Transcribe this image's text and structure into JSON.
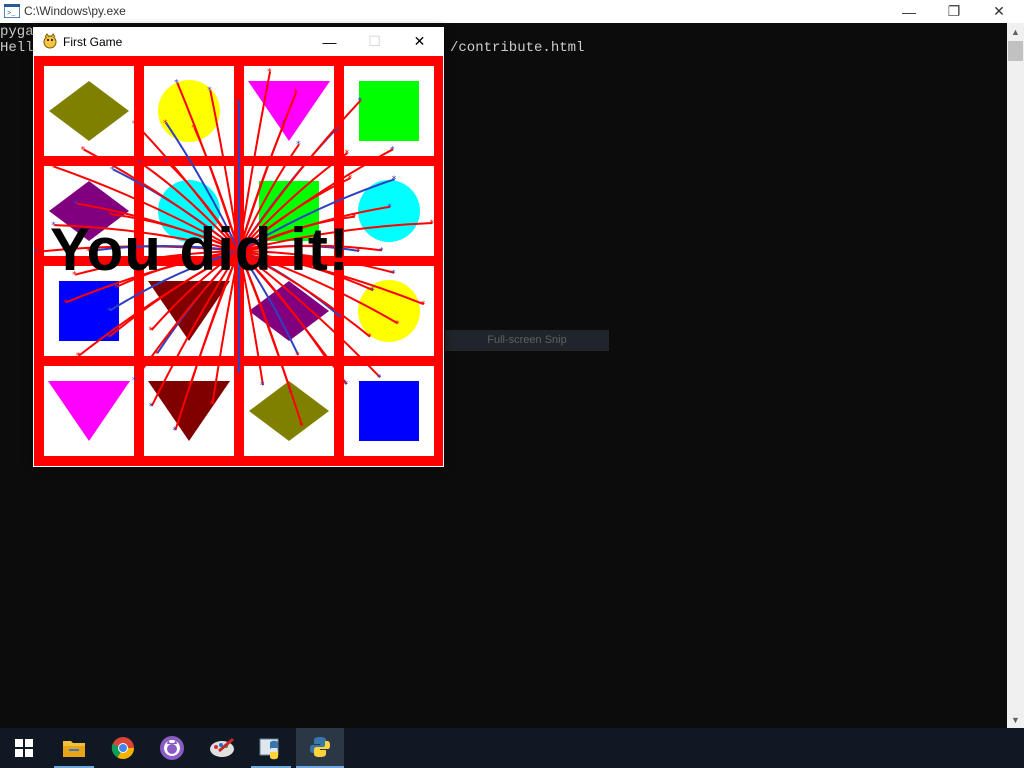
{
  "console": {
    "title": "C:\\Windows\\py.exe",
    "lines": [
      "pygame",
      "Hello"
    ],
    "trailing_text": "/contribute.html",
    "snip_hint": "Full-screen Snip",
    "controls": {
      "minimize": "—",
      "maximize": "❐",
      "close": "✕"
    }
  },
  "game": {
    "title": "First Game",
    "message": "You did it!",
    "controls": {
      "minimize": "—",
      "maximize": "☐",
      "close": "✕"
    },
    "board": {
      "border_color": "#ff0000",
      "cells": [
        {
          "shape": "diamond",
          "color": "#808000"
        },
        {
          "shape": "circle",
          "color": "#ffff00"
        },
        {
          "shape": "triangle",
          "color": "#ff00ff"
        },
        {
          "shape": "square",
          "color": "#00ff00"
        },
        {
          "shape": "diamond",
          "color": "#800080"
        },
        {
          "shape": "circle",
          "color": "#00ffff"
        },
        {
          "shape": "square",
          "color": "#00ff00"
        },
        {
          "shape": "circle",
          "color": "#00ffff"
        },
        {
          "shape": "square",
          "color": "#0000ff"
        },
        {
          "shape": "triangle",
          "color": "#800000"
        },
        {
          "shape": "diamond",
          "color": "#800080"
        },
        {
          "shape": "circle",
          "color": "#ffff00"
        },
        {
          "shape": "triangle",
          "color": "#ff00ff"
        },
        {
          "shape": "triangle",
          "color": "#800000"
        },
        {
          "shape": "diamond",
          "color": "#808000"
        },
        {
          "shape": "square",
          "color": "#0000ff"
        }
      ]
    },
    "firework_colors": [
      "#ff0000",
      "#3040c0"
    ]
  },
  "taskbar": {
    "items": [
      {
        "name": "start-icon"
      },
      {
        "name": "file-explorer-icon"
      },
      {
        "name": "chrome-icon"
      },
      {
        "name": "github-desktop-icon"
      },
      {
        "name": "paint-icon"
      },
      {
        "name": "python-idle-icon"
      },
      {
        "name": "python-icon"
      }
    ]
  }
}
